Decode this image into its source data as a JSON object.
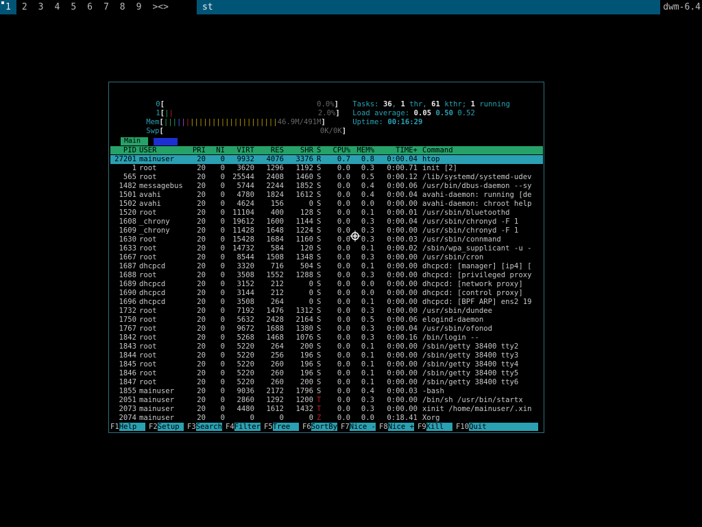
{
  "bar": {
    "tags": [
      "1",
      "2",
      "3",
      "4",
      "5",
      "6",
      "7",
      "8",
      "9"
    ],
    "selected_tag": "1",
    "layout": "><>",
    "window_title": "st",
    "status": "dwm-6.4"
  },
  "htop": {
    "cpu0": {
      "label": "0",
      "value": "0.0%"
    },
    "cpu1": {
      "label": "1",
      "value": "2.0%"
    },
    "mem": {
      "label": "Mem",
      "value": "46.9M/491M"
    },
    "swp": {
      "label": "Swp",
      "value": "0K/0K"
    },
    "tasks_label": "Tasks:",
    "tasks_count": "36",
    "threads": "1",
    "thr_label": "thr,",
    "kthreads": "61",
    "kthr_label": "kthr;",
    "running": "1",
    "running_label": "running",
    "load_label": "Load average:",
    "load1": "0.05",
    "load5": "0.50",
    "load15": "0.52",
    "uptime_label": "Uptime:",
    "uptime": "00:16:29",
    "tab_main": "Main",
    "headers": {
      "pid": "PID",
      "user": "USER",
      "pri": "PRI",
      "ni": "NI",
      "virt": "VIRT",
      "res": "RES",
      "shr": "SHR",
      "s": "S",
      "cpu": "CPU%",
      "mem": "MEM%",
      "time": "TIME+",
      "command": "Command"
    },
    "processes": [
      {
        "pid": "27201",
        "user": "mainuser",
        "pri": "20",
        "ni": "0",
        "virt": "9932",
        "res": "4076",
        "shr": "3376",
        "s": "R",
        "cpu": "0.7",
        "mem": "0.8",
        "time": "0:00.04",
        "cmd": "htop"
      },
      {
        "pid": "1",
        "user": "root",
        "pri": "20",
        "ni": "0",
        "virt": "3620",
        "res": "1296",
        "shr": "1192",
        "s": "S",
        "cpu": "0.0",
        "mem": "0.3",
        "time": "0:00.71",
        "cmd": "init [2]"
      },
      {
        "pid": "565",
        "user": "root",
        "pri": "20",
        "ni": "0",
        "virt": "25544",
        "res": "2408",
        "shr": "1460",
        "s": "S",
        "cpu": "0.0",
        "mem": "0.5",
        "time": "0:00.12",
        "cmd": "/lib/systemd/systemd-udev"
      },
      {
        "pid": "1482",
        "user": "messagebus",
        "pri": "20",
        "ni": "0",
        "virt": "5744",
        "res": "2244",
        "shr": "1852",
        "s": "S",
        "cpu": "0.0",
        "mem": "0.4",
        "time": "0:00.06",
        "cmd": "/usr/bin/dbus-daemon --sy"
      },
      {
        "pid": "1501",
        "user": "avahi",
        "pri": "20",
        "ni": "0",
        "virt": "4780",
        "res": "1824",
        "shr": "1612",
        "s": "S",
        "cpu": "0.0",
        "mem": "0.4",
        "time": "0:00.04",
        "cmd": "avahi-daemon: running [de"
      },
      {
        "pid": "1502",
        "user": "avahi",
        "pri": "20",
        "ni": "0",
        "virt": "4624",
        "res": "156",
        "shr": "0",
        "s": "S",
        "cpu": "0.0",
        "mem": "0.0",
        "time": "0:00.00",
        "cmd": "avahi-daemon: chroot help"
      },
      {
        "pid": "1520",
        "user": "root",
        "pri": "20",
        "ni": "0",
        "virt": "11104",
        "res": "400",
        "shr": "128",
        "s": "S",
        "cpu": "0.0",
        "mem": "0.1",
        "time": "0:00.01",
        "cmd": "/usr/sbin/bluetoothd"
      },
      {
        "pid": "1608",
        "user": "_chrony",
        "pri": "20",
        "ni": "0",
        "virt": "19612",
        "res": "1600",
        "shr": "1144",
        "s": "S",
        "cpu": "0.0",
        "mem": "0.3",
        "time": "0:00.04",
        "cmd": "/usr/sbin/chronyd -F 1"
      },
      {
        "pid": "1609",
        "user": "_chrony",
        "pri": "20",
        "ni": "0",
        "virt": "11428",
        "res": "1648",
        "shr": "1224",
        "s": "S",
        "cpu": "0.0",
        "mem": "0.3",
        "time": "0:00.00",
        "cmd": "/usr/sbin/chronyd -F 1"
      },
      {
        "pid": "1630",
        "user": "root",
        "pri": "20",
        "ni": "0",
        "virt": "15428",
        "res": "1684",
        "shr": "1160",
        "s": "S",
        "cpu": "0.0",
        "mem": "0.3",
        "time": "0:00.03",
        "cmd": "/usr/sbin/connmand"
      },
      {
        "pid": "1633",
        "user": "root",
        "pri": "20",
        "ni": "0",
        "virt": "14732",
        "res": "584",
        "shr": "120",
        "s": "S",
        "cpu": "0.0",
        "mem": "0.1",
        "time": "0:00.02",
        "cmd": "/sbin/wpa_supplicant -u -"
      },
      {
        "pid": "1667",
        "user": "root",
        "pri": "20",
        "ni": "0",
        "virt": "8544",
        "res": "1508",
        "shr": "1348",
        "s": "S",
        "cpu": "0.0",
        "mem": "0.3",
        "time": "0:00.00",
        "cmd": "/usr/sbin/cron"
      },
      {
        "pid": "1687",
        "user": "dhcpcd",
        "pri": "20",
        "ni": "0",
        "virt": "3320",
        "res": "716",
        "shr": "504",
        "s": "S",
        "cpu": "0.0",
        "mem": "0.1",
        "time": "0:00.00",
        "cmd": "dhcpcd: [manager] [ip4] ["
      },
      {
        "pid": "1688",
        "user": "root",
        "pri": "20",
        "ni": "0",
        "virt": "3508",
        "res": "1552",
        "shr": "1288",
        "s": "S",
        "cpu": "0.0",
        "mem": "0.3",
        "time": "0:00.00",
        "cmd": "dhcpcd: [privileged proxy"
      },
      {
        "pid": "1689",
        "user": "dhcpcd",
        "pri": "20",
        "ni": "0",
        "virt": "3152",
        "res": "212",
        "shr": "0",
        "s": "S",
        "cpu": "0.0",
        "mem": "0.0",
        "time": "0:00.00",
        "cmd": "dhcpcd: [network proxy]"
      },
      {
        "pid": "1690",
        "user": "dhcpcd",
        "pri": "20",
        "ni": "0",
        "virt": "3144",
        "res": "212",
        "shr": "0",
        "s": "S",
        "cpu": "0.0",
        "mem": "0.0",
        "time": "0:00.00",
        "cmd": "dhcpcd: [control proxy]"
      },
      {
        "pid": "1696",
        "user": "dhcpcd",
        "pri": "20",
        "ni": "0",
        "virt": "3508",
        "res": "264",
        "shr": "0",
        "s": "S",
        "cpu": "0.0",
        "mem": "0.1",
        "time": "0:00.00",
        "cmd": "dhcpcd: [BPF ARP] ens2 19"
      },
      {
        "pid": "1732",
        "user": "root",
        "pri": "20",
        "ni": "0",
        "virt": "7192",
        "res": "1476",
        "shr": "1312",
        "s": "S",
        "cpu": "0.0",
        "mem": "0.3",
        "time": "0:00.00",
        "cmd": "/usr/sbin/dundee"
      },
      {
        "pid": "1750",
        "user": "root",
        "pri": "20",
        "ni": "0",
        "virt": "5632",
        "res": "2428",
        "shr": "2164",
        "s": "S",
        "cpu": "0.0",
        "mem": "0.5",
        "time": "0:00.06",
        "cmd": "elogind-daemon"
      },
      {
        "pid": "1767",
        "user": "root",
        "pri": "20",
        "ni": "0",
        "virt": "9672",
        "res": "1688",
        "shr": "1380",
        "s": "S",
        "cpu": "0.0",
        "mem": "0.3",
        "time": "0:00.04",
        "cmd": "/usr/sbin/ofonod"
      },
      {
        "pid": "1842",
        "user": "root",
        "pri": "20",
        "ni": "0",
        "virt": "5268",
        "res": "1468",
        "shr": "1076",
        "s": "S",
        "cpu": "0.0",
        "mem": "0.3",
        "time": "0:00.16",
        "cmd": "/bin/login --"
      },
      {
        "pid": "1843",
        "user": "root",
        "pri": "20",
        "ni": "0",
        "virt": "5220",
        "res": "264",
        "shr": "200",
        "s": "S",
        "cpu": "0.0",
        "mem": "0.1",
        "time": "0:00.00",
        "cmd": "/sbin/getty 38400 tty2"
      },
      {
        "pid": "1844",
        "user": "root",
        "pri": "20",
        "ni": "0",
        "virt": "5220",
        "res": "256",
        "shr": "196",
        "s": "S",
        "cpu": "0.0",
        "mem": "0.1",
        "time": "0:00.00",
        "cmd": "/sbin/getty 38400 tty3"
      },
      {
        "pid": "1845",
        "user": "root",
        "pri": "20",
        "ni": "0",
        "virt": "5220",
        "res": "260",
        "shr": "196",
        "s": "S",
        "cpu": "0.0",
        "mem": "0.1",
        "time": "0:00.00",
        "cmd": "/sbin/getty 38400 tty4"
      },
      {
        "pid": "1846",
        "user": "root",
        "pri": "20",
        "ni": "0",
        "virt": "5220",
        "res": "260",
        "shr": "196",
        "s": "S",
        "cpu": "0.0",
        "mem": "0.1",
        "time": "0:00.00",
        "cmd": "/sbin/getty 38400 tty5"
      },
      {
        "pid": "1847",
        "user": "root",
        "pri": "20",
        "ni": "0",
        "virt": "5220",
        "res": "260",
        "shr": "200",
        "s": "S",
        "cpu": "0.0",
        "mem": "0.1",
        "time": "0:00.00",
        "cmd": "/sbin/getty 38400 tty6"
      },
      {
        "pid": "1855",
        "user": "mainuser",
        "pri": "20",
        "ni": "0",
        "virt": "9036",
        "res": "2172",
        "shr": "1796",
        "s": "S",
        "cpu": "0.0",
        "mem": "0.4",
        "time": "0:00.03",
        "cmd": "-bash"
      },
      {
        "pid": "2051",
        "user": "mainuser",
        "pri": "20",
        "ni": "0",
        "virt": "2860",
        "res": "1292",
        "shr": "1200",
        "s": "T",
        "cpu": "0.0",
        "mem": "0.3",
        "time": "0:00.00",
        "cmd": "/bin/sh /usr/bin/startx"
      },
      {
        "pid": "2073",
        "user": "mainuser",
        "pri": "20",
        "ni": "0",
        "virt": "4480",
        "res": "1612",
        "shr": "1432",
        "s": "T",
        "cpu": "0.0",
        "mem": "0.3",
        "time": "0:00.00",
        "cmd": "xinit /home/mainuser/.xin"
      },
      {
        "pid": "2074",
        "user": "mainuser",
        "pri": "20",
        "ni": "0",
        "virt": "0",
        "res": "0",
        "shr": "0",
        "s": "Z",
        "cpu": "0.0",
        "mem": "0.0",
        "time": "0:18.41",
        "cmd": "Xorg"
      }
    ],
    "fkeys": [
      {
        "key": "F1",
        "label": "Help  "
      },
      {
        "key": "F2",
        "label": "Setup "
      },
      {
        "key": "F3",
        "label": "Search"
      },
      {
        "key": "F4",
        "label": "Filter"
      },
      {
        "key": "F5",
        "label": "Tree  "
      },
      {
        "key": "F6",
        "label": "SortBy"
      },
      {
        "key": "F7",
        "label": "Nice -"
      },
      {
        "key": "F8",
        "label": "Nice +"
      },
      {
        "key": "F9",
        "label": "Kill  "
      },
      {
        "key": "F10",
        "label": "Quit"
      }
    ]
  }
}
